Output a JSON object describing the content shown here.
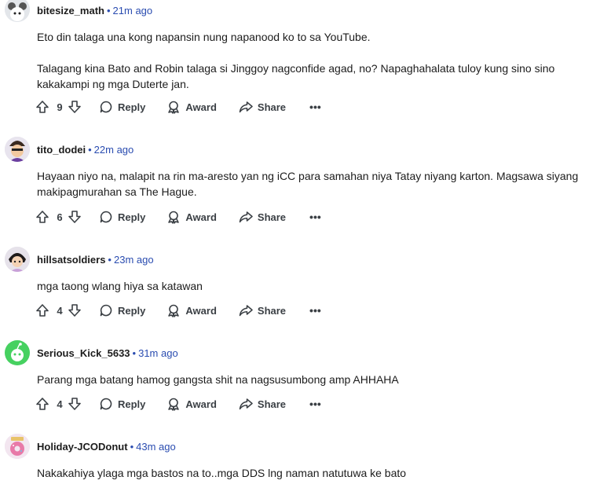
{
  "actions": {
    "reply_label": "Reply",
    "award_label": "Award",
    "share_label": "Share",
    "more_label": "•••"
  },
  "comments": [
    {
      "author": "bitesize_math",
      "time": "21m ago",
      "paragraphs": [
        "Eto din talaga una kong napansin nung napanood ko to sa YouTube.",
        "Talagang kina Bato and Robin talaga si Jinggoy nagconfide agad, no? Napaghahalata tuloy kung sino sino kakakampi ng mga Duterte jan."
      ],
      "votes": "9",
      "avatar_color": "#e3e6ea"
    },
    {
      "author": "tito_dodei",
      "time": "22m ago",
      "paragraphs": [
        "Hayaan niyo na, malapit na rin ma-aresto yan ng iCC para samahan niya Tatay niyang karton. Magsawa siyang makipagmurahan sa The Hague."
      ],
      "votes": "6",
      "avatar_color": "#e8e4ee"
    },
    {
      "author": "hillsatsoldiers",
      "time": "23m ago",
      "paragraphs": [
        "mga taong wlang hiya sa katawan"
      ],
      "votes": "4",
      "avatar_color": "#e6e2ea"
    },
    {
      "author": "Serious_Kick_5633",
      "time": "31m ago",
      "paragraphs": [
        "Parang mga batang hamog gangsta shit na nagsusumbong amp AHHAHA"
      ],
      "votes": "4",
      "avatar_color": "#46d160"
    },
    {
      "author": "Holiday-JCODonut",
      "time": "43m ago",
      "paragraphs": [
        "Nakakahiya ylaga mga bastos na to..mga DDS lng naman natutuwa ke bato"
      ],
      "votes": "",
      "avatar_color": "#f3e6f0"
    }
  ]
}
